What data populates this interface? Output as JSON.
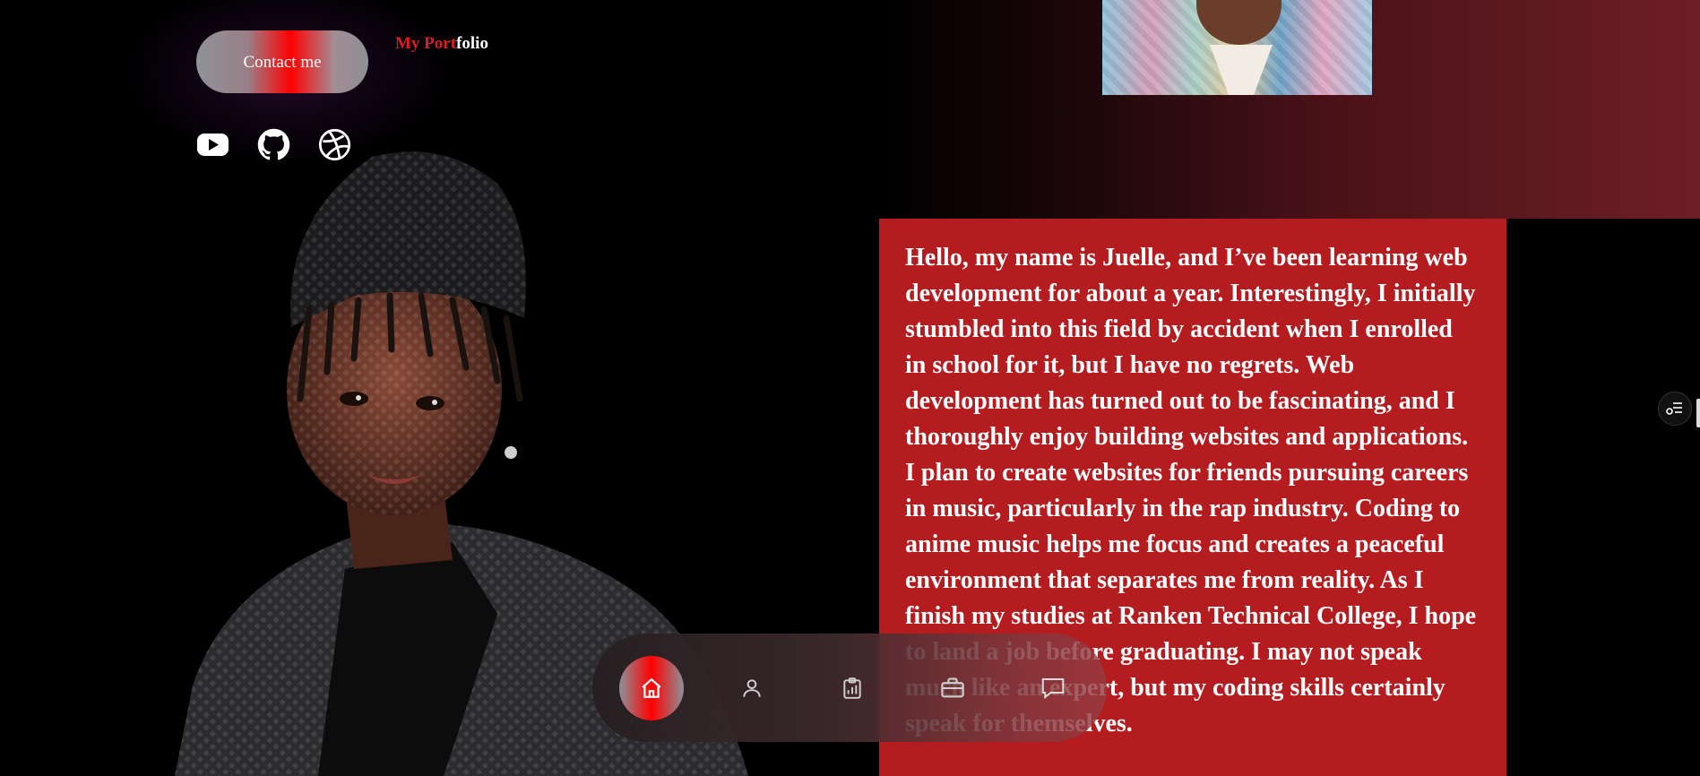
{
  "header": {
    "contact_button_label": "Contact me",
    "logo": {
      "part1": "My Port",
      "part2": "folio"
    }
  },
  "socials": [
    {
      "name": "youtube-icon"
    },
    {
      "name": "github-icon"
    },
    {
      "name": "dribbble-icon"
    }
  ],
  "bio": {
    "text": "Hello, my name is Juelle, and I’ve been learning web development for about a year. Interestingly, I initially stumbled into this field by accident when I enrolled in school for it, but I have no regrets. Web development has turned out to be fascinating, and I thoroughly enjoy building websites and applications. I plan to create websites for friends pursuing careers in music, particularly in the rap industry. Coding to anime music helps me focus and creates a peaceful environment that separates me from reality. As I finish my studies at Ranken Technical College, I hope to land a job before graduating. I may not speak much like an expert, but my coding skills certainly speak for themselves."
  },
  "nav": {
    "items": [
      {
        "icon": "home-icon",
        "active": true
      },
      {
        "icon": "user-icon",
        "active": false
      },
      {
        "icon": "clipboard-chart-icon",
        "active": false
      },
      {
        "icon": "briefcase-icon",
        "active": false
      },
      {
        "icon": "chat-icon",
        "active": false
      }
    ]
  },
  "colors": {
    "accent": "#e01b25",
    "bio_card": "#b51c1f",
    "background": "#000000"
  }
}
